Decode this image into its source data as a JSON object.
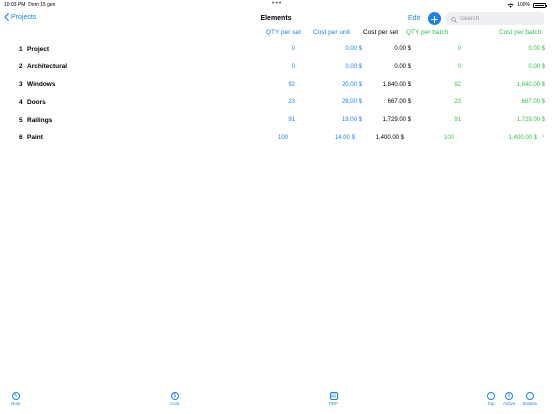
{
  "status_bar": {
    "time": "10:03 PM",
    "date": "Dom 15 gen",
    "battery": "100%"
  },
  "nav": {
    "back_label": "Projects",
    "title": "Elements",
    "edit_label": "Edit",
    "add_icon": "plus-icon",
    "search_placeholder": "Search"
  },
  "columns": {
    "qty_per_set": "QTY per set",
    "cost_per_unit": "Cost per unit",
    "cost_per_set": "Cost per set",
    "qty_per_batch": "QTY per batch",
    "cost_per_batch": "Cost per batch"
  },
  "rows": [
    {
      "num": "1",
      "name": "Project",
      "qty_per_set": "0",
      "cost_per_unit": "0.00 $",
      "cost_per_set": "0.00 $",
      "qty_per_batch": "0",
      "cost_per_batch": "0.00 $"
    },
    {
      "num": "2",
      "name": "Architectural",
      "qty_per_set": "0",
      "cost_per_unit": "0.00 $",
      "cost_per_set": "0.00 $",
      "qty_per_batch": "0",
      "cost_per_batch": "0.00 $"
    },
    {
      "num": "3",
      "name": "Windows",
      "qty_per_set": "92",
      "cost_per_unit": "20.00 $",
      "cost_per_set": "1,840.00 $",
      "qty_per_batch": "92",
      "cost_per_batch": "1,840.00 $"
    },
    {
      "num": "4",
      "name": "Doors",
      "qty_per_set": "23",
      "cost_per_unit": "29.00 $",
      "cost_per_set": "667.00 $",
      "qty_per_batch": "23",
      "cost_per_batch": "667.00 $"
    },
    {
      "num": "5",
      "name": "Railings",
      "qty_per_set": "91",
      "cost_per_unit": "19.00 $",
      "cost_per_set": "1,729.00 $",
      "qty_per_batch": "91",
      "cost_per_batch": "1,729.00 $"
    },
    {
      "num": "6",
      "name": "Paint",
      "qty_per_set": "100",
      "cost_per_unit": "14.00 $",
      "cost_per_set": "1,400.00 $",
      "qty_per_batch": "100",
      "cost_per_batch": "1,400.00 $"
    }
  ],
  "toolbar": {
    "note_label": "Note",
    "cost_label": "Cost",
    "pdf_label": "PDF",
    "top_label": "Top",
    "active_label": "Active",
    "bottom_label": "Bottom"
  },
  "colors": {
    "accent_blue": "#1a82f0",
    "accent_green": "#33c24d"
  }
}
